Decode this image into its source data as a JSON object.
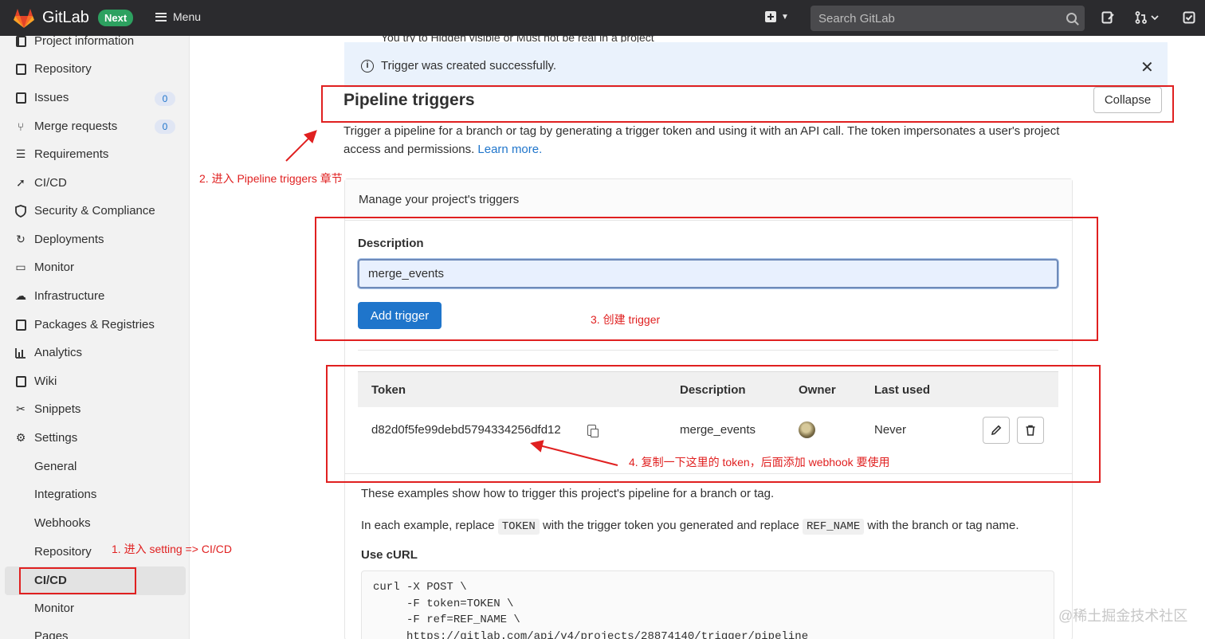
{
  "topbar": {
    "brand": "GitLab",
    "next_badge": "Next",
    "menu_label": "Menu",
    "search_placeholder": "Search GitLab"
  },
  "sidebar": {
    "items": [
      {
        "label": "Project information",
        "icon": "project-info-icon"
      },
      {
        "label": "Repository",
        "icon": "repository-icon"
      },
      {
        "label": "Issues",
        "icon": "issues-icon",
        "count": "0"
      },
      {
        "label": "Merge requests",
        "icon": "merge-request-icon",
        "count": "0"
      },
      {
        "label": "Requirements",
        "icon": "requirements-icon"
      },
      {
        "label": "CI/CD",
        "icon": "rocket-icon"
      },
      {
        "label": "Security & Compliance",
        "icon": "shield-icon"
      },
      {
        "label": "Deployments",
        "icon": "deployments-icon"
      },
      {
        "label": "Monitor",
        "icon": "monitor-icon"
      },
      {
        "label": "Infrastructure",
        "icon": "cloud-icon"
      },
      {
        "label": "Packages & Registries",
        "icon": "package-icon"
      },
      {
        "label": "Analytics",
        "icon": "chart-icon"
      },
      {
        "label": "Wiki",
        "icon": "book-icon"
      },
      {
        "label": "Snippets",
        "icon": "scissors-icon"
      },
      {
        "label": "Settings",
        "icon": "gear-icon"
      }
    ],
    "settings_sub": [
      "General",
      "Integrations",
      "Webhooks",
      "Repository",
      "CI/CD",
      "Monitor",
      "Pages"
    ]
  },
  "alert": {
    "text": "Trigger was created successfully.",
    "cut_text": "You try to Hidden visible or Must not be real in a project"
  },
  "section": {
    "title": "Pipeline triggers",
    "collapse_label": "Collapse",
    "desc": "Trigger a pipeline for a branch or tag by generating a trigger token and using it with an API call. The token impersonates a user's project access and permissions. ",
    "learn_more": "Learn more."
  },
  "card": {
    "header": "Manage your project's triggers",
    "desc_label": "Description",
    "desc_value": "merge_events",
    "add_button": "Add trigger"
  },
  "table": {
    "columns": [
      "Token",
      "Description",
      "Owner",
      "Last used"
    ],
    "rows": [
      {
        "token": "d82d0f5fe99debd5794334256dfd12",
        "description": "merge_events",
        "last_used": "Never"
      }
    ]
  },
  "examples": {
    "line1": "These examples show how to trigger this project's pipeline for a branch or tag.",
    "line2_a": "In each example, replace ",
    "line2_token": "TOKEN",
    "line2_b": " with the trigger token you generated and replace ",
    "line2_ref": "REF_NAME",
    "line2_c": " with the branch or tag name.",
    "curl_title": "Use cURL",
    "curl_code": "curl -X POST \\\n     -F token=TOKEN \\\n     -F ref=REF_NAME \\\n     https://gitlab.com/api/v4/projects/28874140/trigger/pipeline"
  },
  "annotations": {
    "step1": "1. 进入 setting => CI/CD",
    "step2": "2. 进入 Pipeline triggers 章节",
    "step3": "3. 创建 trigger",
    "step4": "4. 复制一下这里的 token，后面添加 webhook 要使用",
    "color": "#e02020"
  },
  "watermark": "@稀土掘金技术社区"
}
